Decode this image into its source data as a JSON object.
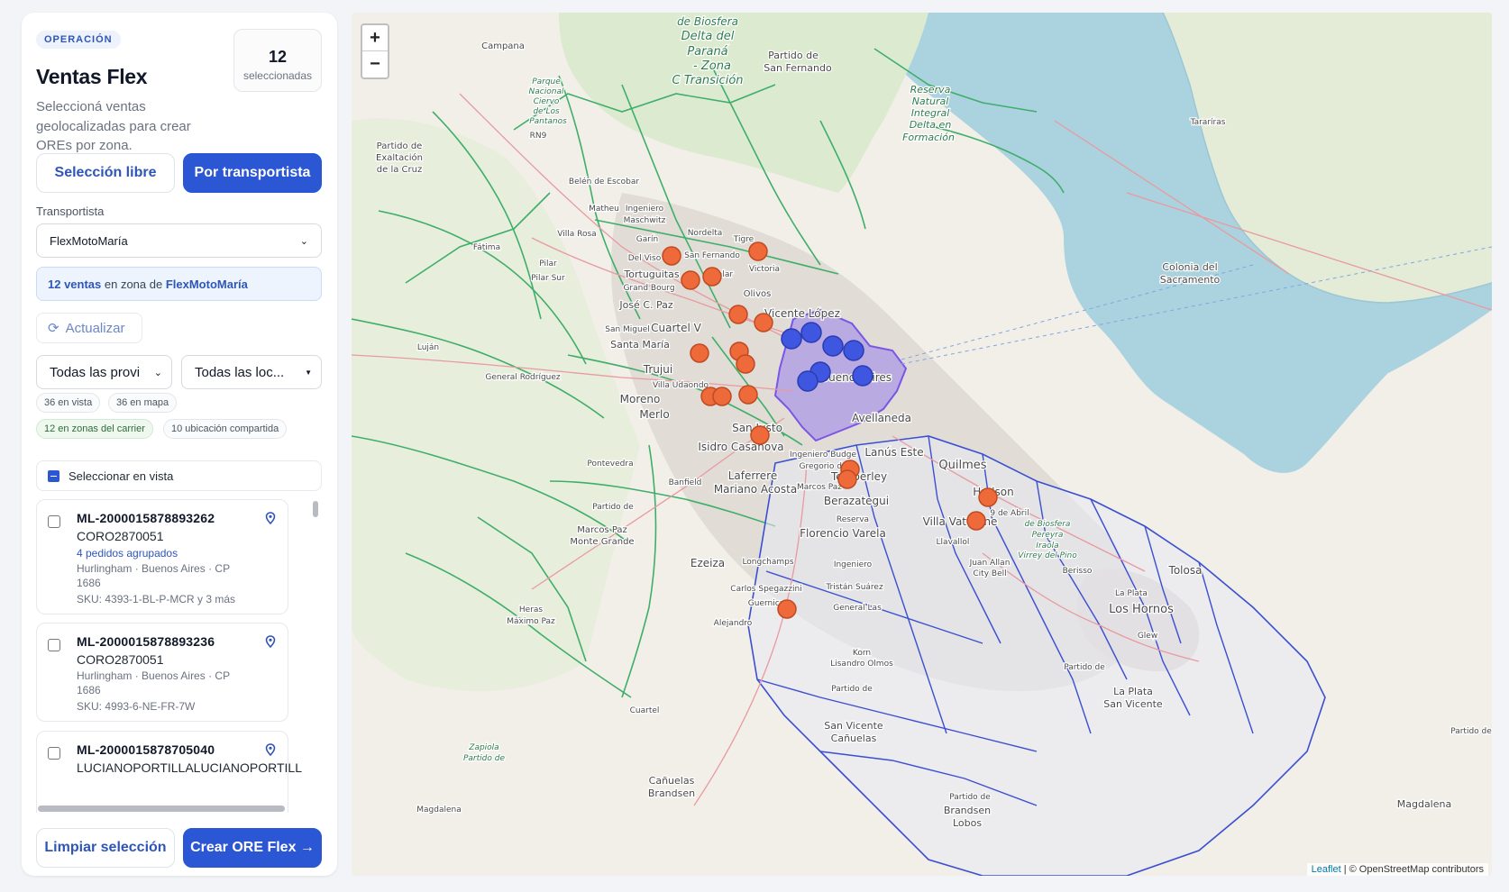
{
  "panel": {
    "tag": "OPERACIÓN",
    "title": "Ventas Flex",
    "subtitle": "Seleccioná ventas geolocalizadas para crear OREs por zona.",
    "selected_count": "12",
    "selected_label": "seleccionadas",
    "mode_free": "Selección libre",
    "mode_carrier": "Por transportista",
    "carrier_label": "Transportista",
    "carrier_value": "FlexMotoMaría",
    "zone_info": {
      "count": "12 ventas",
      "mid": " en zona de ",
      "carrier": "FlexMotoMaría"
    },
    "refresh_label": "Actualizar",
    "filter_province": "Todas las provi",
    "filter_locality": "Todas las loc...",
    "chips": {
      "in_view": "36 en vista",
      "in_map": "36 en mapa",
      "in_zones": "12 en zonas del carrier",
      "shared": "10 ubicación compartida"
    },
    "select_in_view": "Seleccionar en vista",
    "orders": [
      {
        "id": "ML-2000015878893262",
        "code": "CORO2870051",
        "group": "4 pedidos agrupados",
        "location": "Hurlingham · Buenos Aires · CP 1686",
        "sku": "SKU: 4393-1-BL-P-MCR y 3 más"
      },
      {
        "id": "ML-2000015878893236",
        "code": "CORO2870051",
        "location": "Hurlingham · Buenos Aires · CP 1686",
        "sku": "SKU: 4993-6-NE-FR-7W"
      },
      {
        "id": "ML-2000015878705040",
        "code": "LUCIANOPORTILLALUCIANOPORTILL"
      }
    ],
    "clear_label": "Limpiar selección",
    "create_label": "Crear ORE Flex →"
  },
  "map": {
    "zoom_in": "+",
    "zoom_out": "−",
    "attribution_leaflet": "Leaflet",
    "attribution_rest": " | © OpenStreetMap contributors",
    "labels": [
      "de Biosfera",
      "Delta del",
      "Paraná",
      "- Zona",
      "C Transición",
      "Partido de",
      "San Fernando",
      "Campana",
      "Parque",
      "Nacional",
      "Ciervo",
      "de Los",
      "Pantanos",
      "RN9",
      "Partido de",
      "Exaltación",
      "de la Cruz",
      "Reserva",
      "Natural",
      "Integral",
      "Delta en",
      "Formación",
      "Tararíras",
      "Colonia del",
      "Sacramento",
      "Belén de Escobar",
      "Matheu",
      "Ingeniero",
      "Maschwitz",
      "Nordelta",
      "Villa Rosa",
      "Garín",
      "Tigre",
      "Fátima",
      "Del Viso",
      "San Fernando",
      "Victoria",
      "Pilar",
      "Tortuguitas",
      "El Talar",
      "Pilar Sur",
      "Grand Bourg",
      "Olivos",
      "Vicente López",
      "José C. Paz",
      "San Miguel",
      "Cuartel V",
      "Santa María",
      "Luján",
      "Trujui",
      "General Rodríguez",
      "Villa Udaondo",
      "Moreno",
      "Buenos Aires",
      "Avellaneda",
      "Merlo",
      "San Justo",
      "Isidro Casanova",
      "Lanús Este",
      "Quilmes",
      "Ingeniero Budge",
      "Gregorio de",
      "Laferrere",
      "Mariano Acosta",
      "Pontevedra",
      "Banfield",
      "Temperley",
      "Berazategui",
      "Hudson",
      "9 de Abril",
      "Marcos Paz",
      "Partido de",
      "Marcos Paz",
      "Monte Grande",
      "Florencio Varela",
      "Villa Vatteone",
      "Llavallol",
      "Reserva",
      "de Biosfera",
      "Pereyra",
      "Iraola",
      "Virrey del Pino",
      "Ezeiza",
      "Longchamps",
      "Ingeniero",
      "Juan Allan",
      "City Bell",
      "Berisso",
      "Tolosa",
      "La Plata",
      "Los Hornos",
      "Glew",
      "Tristán Suárez",
      "Carlos Spegazzini",
      "Guernica",
      "General Las",
      "Heras",
      "Máximo Paz",
      "Alejandro",
      "Korn",
      "Lisandro Olmos",
      "Partido de",
      "La Plata",
      "San Vicente",
      "Partido de",
      "San Vicente",
      "Cañuelas",
      "Cuartel",
      "Zapiola",
      "Partido de",
      "Cañuelas",
      "Brandsen",
      "Partido de",
      "Brandsen",
      "Lobos",
      "Magdalena",
      "Partido de",
      "Magdalena"
    ]
  }
}
